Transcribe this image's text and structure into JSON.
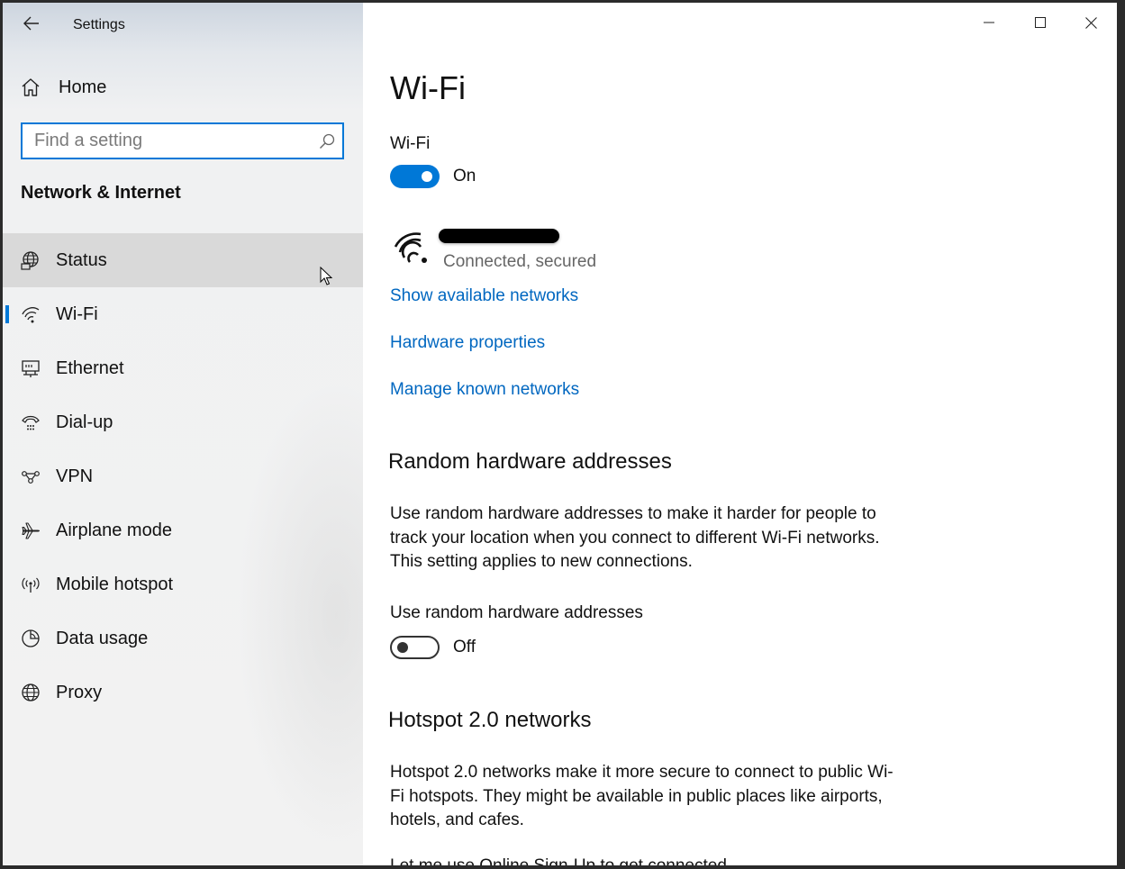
{
  "window": {
    "app_title": "Settings",
    "controls": {
      "minimize": "minimize-icon",
      "maximize": "maximize-icon",
      "close": "close-icon"
    }
  },
  "sidebar": {
    "home_label": "Home",
    "search": {
      "placeholder": "Find a setting",
      "value": ""
    },
    "section_title": "Network & Internet",
    "items": [
      {
        "label": "Status",
        "icon": "globe-status-icon",
        "state": "hover"
      },
      {
        "label": "Wi-Fi",
        "icon": "wifi-icon",
        "state": "selected"
      },
      {
        "label": "Ethernet",
        "icon": "ethernet-icon"
      },
      {
        "label": "Dial-up",
        "icon": "dialup-icon"
      },
      {
        "label": "VPN",
        "icon": "vpn-icon"
      },
      {
        "label": "Airplane mode",
        "icon": "airplane-icon"
      },
      {
        "label": "Mobile hotspot",
        "icon": "hotspot-icon"
      },
      {
        "label": "Data usage",
        "icon": "data-usage-icon"
      },
      {
        "label": "Proxy",
        "icon": "globe-icon"
      }
    ]
  },
  "main": {
    "page_title": "Wi-Fi",
    "wifi_toggle": {
      "label": "Wi-Fi",
      "state": "On"
    },
    "current_network": {
      "status": "Connected, secured"
    },
    "links": {
      "show_networks": "Show available networks",
      "hardware_properties": "Hardware properties",
      "manage_known": "Manage known networks"
    },
    "random_hw": {
      "heading": "Random hardware addresses",
      "description": "Use random hardware addresses to make it harder for people to track your location when you connect to different Wi-Fi networks. This setting applies to new connections.",
      "toggle_label": "Use random hardware addresses",
      "toggle_state": "Off"
    },
    "hotspot20": {
      "heading": "Hotspot 2.0 networks",
      "description": "Hotspot 2.0 networks make it more secure to connect to public Wi-Fi hotspots. They might be available in public places like airports, hotels, and cafes.",
      "cut_off_text": "Let me use Online Sign-Up to get connected"
    }
  },
  "colors": {
    "accent": "#0078d7",
    "link": "#0067c0"
  }
}
